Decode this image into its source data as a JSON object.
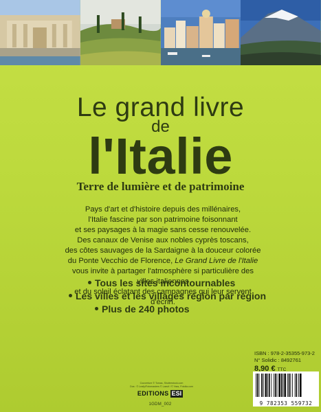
{
  "photos": [
    {
      "name": "trevi-fountain-photo"
    },
    {
      "name": "tuscany-hills-photo"
    },
    {
      "name": "procida-harbor-photo"
    },
    {
      "name": "etna-volcano-photo"
    }
  ],
  "title": {
    "line1": "Le grand livre",
    "line2": "de",
    "line3": "l'Italie"
  },
  "subtitle": "Terre de lumière et de patrimoine",
  "blurb": {
    "lines": [
      "Pays d'art et d'histoire depuis des millénaires,",
      "l'Italie fascine par son patrimoine foisonnant",
      "et ses paysages à la magie sans cesse renouvelée.",
      "Des canaux de Venise aux nobles cyprès toscans,",
      "des côtes sauvages de la Sardaigne à la douceur colorée",
      "du Ponte Vecchio de Florence,",
      "vous invite à partager l'atmosphère si particulière des villes italiennes",
      "et du soleil éclatant des campagnes qui leur servent d'écrin."
    ],
    "italic_title": "Le Grand Livre de l'Italie"
  },
  "bullets": [
    "Tous les sites incontournables",
    "Les villes et les villages région par région",
    "Plus de 240 photos"
  ],
  "isbn": "ISBN : 978-2-35355-973-2",
  "solidic": "N° Solidic : 8492761",
  "price": {
    "value": "8,90 €",
    "suffix": "TTC"
  },
  "barcode_number": "9 782353 559732",
  "credits": {
    "line1": "Couverture © Tomas, Shutterstock.com",
    "line2": "Dos : © Leafy/Fotomasters © Lasvit / © Yass, Fotolia.com"
  },
  "publisher": {
    "name": "EDITIONS",
    "logo": "ESI"
  },
  "code": "1GDM_002",
  "colors": {
    "background": "#bcd93c",
    "text": "#2e3b12"
  }
}
